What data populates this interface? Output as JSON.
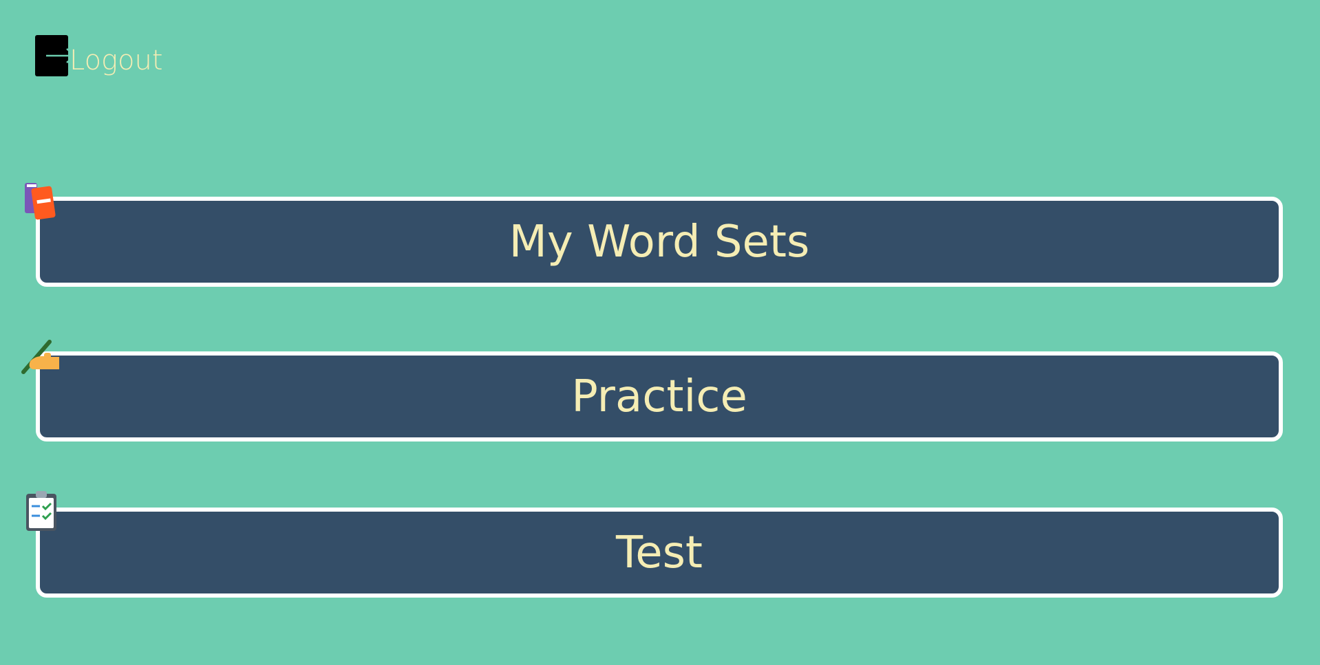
{
  "header": {
    "logout_label": "Logout",
    "logout_icon": "logout-arrow-icon"
  },
  "menu": {
    "items": [
      {
        "label": "My Word Sets",
        "icon": "books-icon"
      },
      {
        "label": "Practice",
        "icon": "writing-hand-icon"
      },
      {
        "label": "Test",
        "icon": "clipboard-check-icon"
      }
    ]
  },
  "colors": {
    "background": "#6dcdb0",
    "button_fill": "#344e68",
    "button_border": "#ffffff",
    "text": "#f5edb4"
  }
}
